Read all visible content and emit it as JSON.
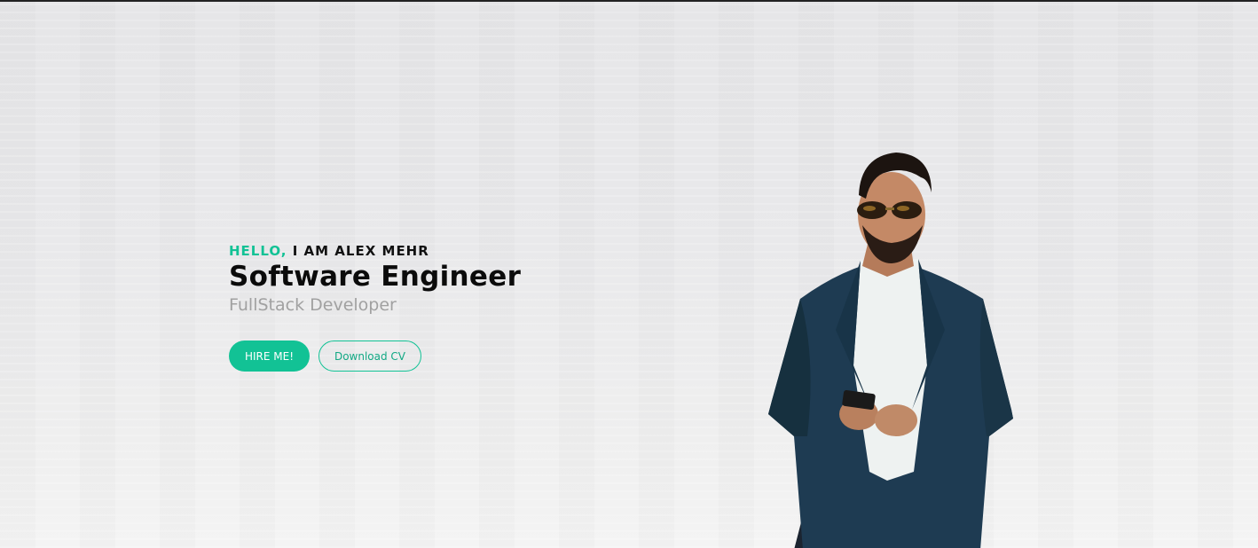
{
  "hero": {
    "greeting_accent": "HELLO,",
    "greeting_rest": "I AM ALEX MEHR",
    "title": "Software Engineer",
    "subtitle": "FullStack Developer",
    "buttons": {
      "hire_label": "HIRE ME!",
      "cv_label": "Download CV"
    }
  },
  "colors": {
    "accent": "#12c295",
    "title": "#0b0b0b",
    "subtitle": "#a1a1a1",
    "background": "#e9e9eb"
  }
}
